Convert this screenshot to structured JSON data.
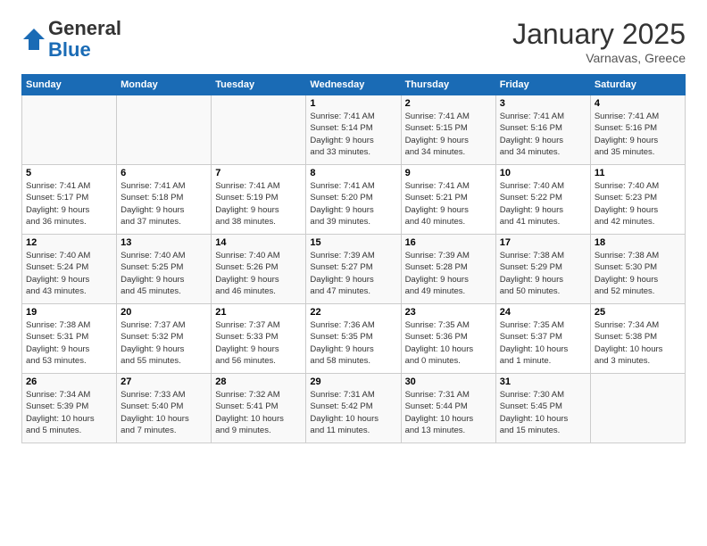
{
  "header": {
    "logo_general": "General",
    "logo_blue": "Blue",
    "title": "January 2025",
    "location": "Varnavas, Greece"
  },
  "days_of_week": [
    "Sunday",
    "Monday",
    "Tuesday",
    "Wednesday",
    "Thursday",
    "Friday",
    "Saturday"
  ],
  "weeks": [
    [
      {
        "day": "",
        "detail": ""
      },
      {
        "day": "",
        "detail": ""
      },
      {
        "day": "",
        "detail": ""
      },
      {
        "day": "1",
        "detail": "Sunrise: 7:41 AM\nSunset: 5:14 PM\nDaylight: 9 hours\nand 33 minutes."
      },
      {
        "day": "2",
        "detail": "Sunrise: 7:41 AM\nSunset: 5:15 PM\nDaylight: 9 hours\nand 34 minutes."
      },
      {
        "day": "3",
        "detail": "Sunrise: 7:41 AM\nSunset: 5:16 PM\nDaylight: 9 hours\nand 34 minutes."
      },
      {
        "day": "4",
        "detail": "Sunrise: 7:41 AM\nSunset: 5:16 PM\nDaylight: 9 hours\nand 35 minutes."
      }
    ],
    [
      {
        "day": "5",
        "detail": "Sunrise: 7:41 AM\nSunset: 5:17 PM\nDaylight: 9 hours\nand 36 minutes."
      },
      {
        "day": "6",
        "detail": "Sunrise: 7:41 AM\nSunset: 5:18 PM\nDaylight: 9 hours\nand 37 minutes."
      },
      {
        "day": "7",
        "detail": "Sunrise: 7:41 AM\nSunset: 5:19 PM\nDaylight: 9 hours\nand 38 minutes."
      },
      {
        "day": "8",
        "detail": "Sunrise: 7:41 AM\nSunset: 5:20 PM\nDaylight: 9 hours\nand 39 minutes."
      },
      {
        "day": "9",
        "detail": "Sunrise: 7:41 AM\nSunset: 5:21 PM\nDaylight: 9 hours\nand 40 minutes."
      },
      {
        "day": "10",
        "detail": "Sunrise: 7:40 AM\nSunset: 5:22 PM\nDaylight: 9 hours\nand 41 minutes."
      },
      {
        "day": "11",
        "detail": "Sunrise: 7:40 AM\nSunset: 5:23 PM\nDaylight: 9 hours\nand 42 minutes."
      }
    ],
    [
      {
        "day": "12",
        "detail": "Sunrise: 7:40 AM\nSunset: 5:24 PM\nDaylight: 9 hours\nand 43 minutes."
      },
      {
        "day": "13",
        "detail": "Sunrise: 7:40 AM\nSunset: 5:25 PM\nDaylight: 9 hours\nand 45 minutes."
      },
      {
        "day": "14",
        "detail": "Sunrise: 7:40 AM\nSunset: 5:26 PM\nDaylight: 9 hours\nand 46 minutes."
      },
      {
        "day": "15",
        "detail": "Sunrise: 7:39 AM\nSunset: 5:27 PM\nDaylight: 9 hours\nand 47 minutes."
      },
      {
        "day": "16",
        "detail": "Sunrise: 7:39 AM\nSunset: 5:28 PM\nDaylight: 9 hours\nand 49 minutes."
      },
      {
        "day": "17",
        "detail": "Sunrise: 7:38 AM\nSunset: 5:29 PM\nDaylight: 9 hours\nand 50 minutes."
      },
      {
        "day": "18",
        "detail": "Sunrise: 7:38 AM\nSunset: 5:30 PM\nDaylight: 9 hours\nand 52 minutes."
      }
    ],
    [
      {
        "day": "19",
        "detail": "Sunrise: 7:38 AM\nSunset: 5:31 PM\nDaylight: 9 hours\nand 53 minutes."
      },
      {
        "day": "20",
        "detail": "Sunrise: 7:37 AM\nSunset: 5:32 PM\nDaylight: 9 hours\nand 55 minutes."
      },
      {
        "day": "21",
        "detail": "Sunrise: 7:37 AM\nSunset: 5:33 PM\nDaylight: 9 hours\nand 56 minutes."
      },
      {
        "day": "22",
        "detail": "Sunrise: 7:36 AM\nSunset: 5:35 PM\nDaylight: 9 hours\nand 58 minutes."
      },
      {
        "day": "23",
        "detail": "Sunrise: 7:35 AM\nSunset: 5:36 PM\nDaylight: 10 hours\nand 0 minutes."
      },
      {
        "day": "24",
        "detail": "Sunrise: 7:35 AM\nSunset: 5:37 PM\nDaylight: 10 hours\nand 1 minute."
      },
      {
        "day": "25",
        "detail": "Sunrise: 7:34 AM\nSunset: 5:38 PM\nDaylight: 10 hours\nand 3 minutes."
      }
    ],
    [
      {
        "day": "26",
        "detail": "Sunrise: 7:34 AM\nSunset: 5:39 PM\nDaylight: 10 hours\nand 5 minutes."
      },
      {
        "day": "27",
        "detail": "Sunrise: 7:33 AM\nSunset: 5:40 PM\nDaylight: 10 hours\nand 7 minutes."
      },
      {
        "day": "28",
        "detail": "Sunrise: 7:32 AM\nSunset: 5:41 PM\nDaylight: 10 hours\nand 9 minutes."
      },
      {
        "day": "29",
        "detail": "Sunrise: 7:31 AM\nSunset: 5:42 PM\nDaylight: 10 hours\nand 11 minutes."
      },
      {
        "day": "30",
        "detail": "Sunrise: 7:31 AM\nSunset: 5:44 PM\nDaylight: 10 hours\nand 13 minutes."
      },
      {
        "day": "31",
        "detail": "Sunrise: 7:30 AM\nSunset: 5:45 PM\nDaylight: 10 hours\nand 15 minutes."
      },
      {
        "day": "",
        "detail": ""
      }
    ]
  ]
}
